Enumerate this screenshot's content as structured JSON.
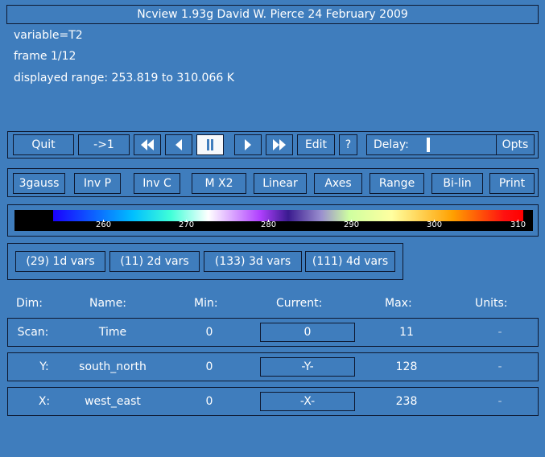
{
  "window": {
    "title": "Ncview 1.93g David W. Pierce  24 February 2009"
  },
  "info": {
    "variable": "variable=T2",
    "frame": "frame 1/12",
    "range": "displayed range: 253.819 to 310.066 K"
  },
  "controls": {
    "quit": "Quit",
    "to_first": "->1",
    "edit": "Edit",
    "help": "?",
    "delay_label": "Delay:",
    "opts": "Opts"
  },
  "options": [
    "3gauss",
    "Inv P",
    "Inv C",
    "M X2",
    "Linear",
    "Axes",
    "Range",
    "Bi-lin",
    "Print"
  ],
  "colorbar": {
    "ticks": [
      "260",
      "270",
      "280",
      "290",
      "300",
      "310"
    ]
  },
  "var_groups": [
    "(29) 1d vars",
    "(11) 2d vars",
    "(133) 3d vars",
    "(111) 4d vars"
  ],
  "dims_header": {
    "dim": "Dim:",
    "name": "Name:",
    "min": "Min:",
    "current": "Current:",
    "max": "Max:",
    "units": "Units:"
  },
  "dims": [
    {
      "dim": "Scan:",
      "name": "Time",
      "min": "0",
      "current": "0",
      "max": "11",
      "units": "-"
    },
    {
      "dim": "Y:",
      "name": "south_north",
      "min": "0",
      "current": "-Y-",
      "max": "128",
      "units": "-"
    },
    {
      "dim": "X:",
      "name": "west_east",
      "min": "0",
      "current": "-X-",
      "max": "238",
      "units": "-"
    }
  ],
  "colors": {
    "background": "#3f7dbd",
    "border": "#0d1830"
  }
}
